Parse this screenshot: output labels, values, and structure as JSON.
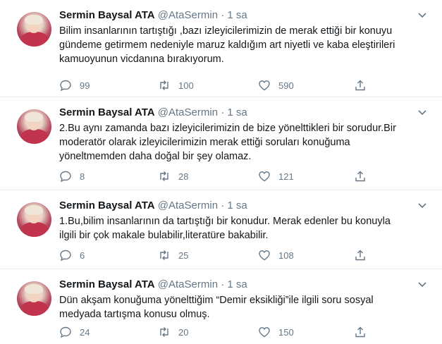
{
  "tweets": [
    {
      "name": "Sermin Baysal ATA",
      "handle": "@AtaSermin",
      "dot": "·",
      "time": "1 sa",
      "lines": [
        "Bilim insanlarının tartıştığı ,bazı izleyicilerimizin de merak ettiği bir konuyu",
        "gündeme getirmem nedeniyle maruz kaldığım art niyetli ve kaba eleştirileri",
        "kamuoyunun vicdanına bırakıyorum."
      ],
      "replies": "99",
      "retweets": "100",
      "likes": "590"
    },
    {
      "name": "Sermin Baysal ATA",
      "handle": "@AtaSermin",
      "dot": "·",
      "time": "1 sa",
      "lines": [
        "2.Bu aynı zamanda bazı izleyicilerimizin de bize yönelttikleri bir sorudur.Bir",
        "moderatör olarak izleyicilerimizin merak ettiği soruları konuğuma",
        "yöneltmemden daha doğal bir şey olamaz."
      ],
      "replies": "8",
      "retweets": "28",
      "likes": "121"
    },
    {
      "name": "Sermin Baysal ATA",
      "handle": "@AtaSermin",
      "dot": "·",
      "time": "1 sa",
      "lines": [
        "1.Bu,bilim insanlarının da tartıştığı  bir konudur. Merak edenler bu konuyla",
        "ilgili bir çok makale bulabilir,literatüre bakabilir."
      ],
      "replies": "6",
      "retweets": "25",
      "likes": "108"
    },
    {
      "name": "Sermin Baysal ATA",
      "handle": "@AtaSermin",
      "dot": "·",
      "time": "1 sa",
      "lines": [
        "Dün akşam konuğuma yönelttiğim “Demir eksikliği”ile ilgili soru sosyal",
        "medyada tartışma konusu olmuş."
      ],
      "replies": "24",
      "retweets": "20",
      "likes": "150"
    }
  ],
  "icons": {
    "reply": "reply-icon",
    "retweet": "retweet-icon",
    "like": "heart-icon",
    "share": "share-icon",
    "menu": "chevron-down-icon"
  },
  "colors": {
    "text": "#14171a",
    "muted": "#657786",
    "divider": "#e6ecf0"
  }
}
